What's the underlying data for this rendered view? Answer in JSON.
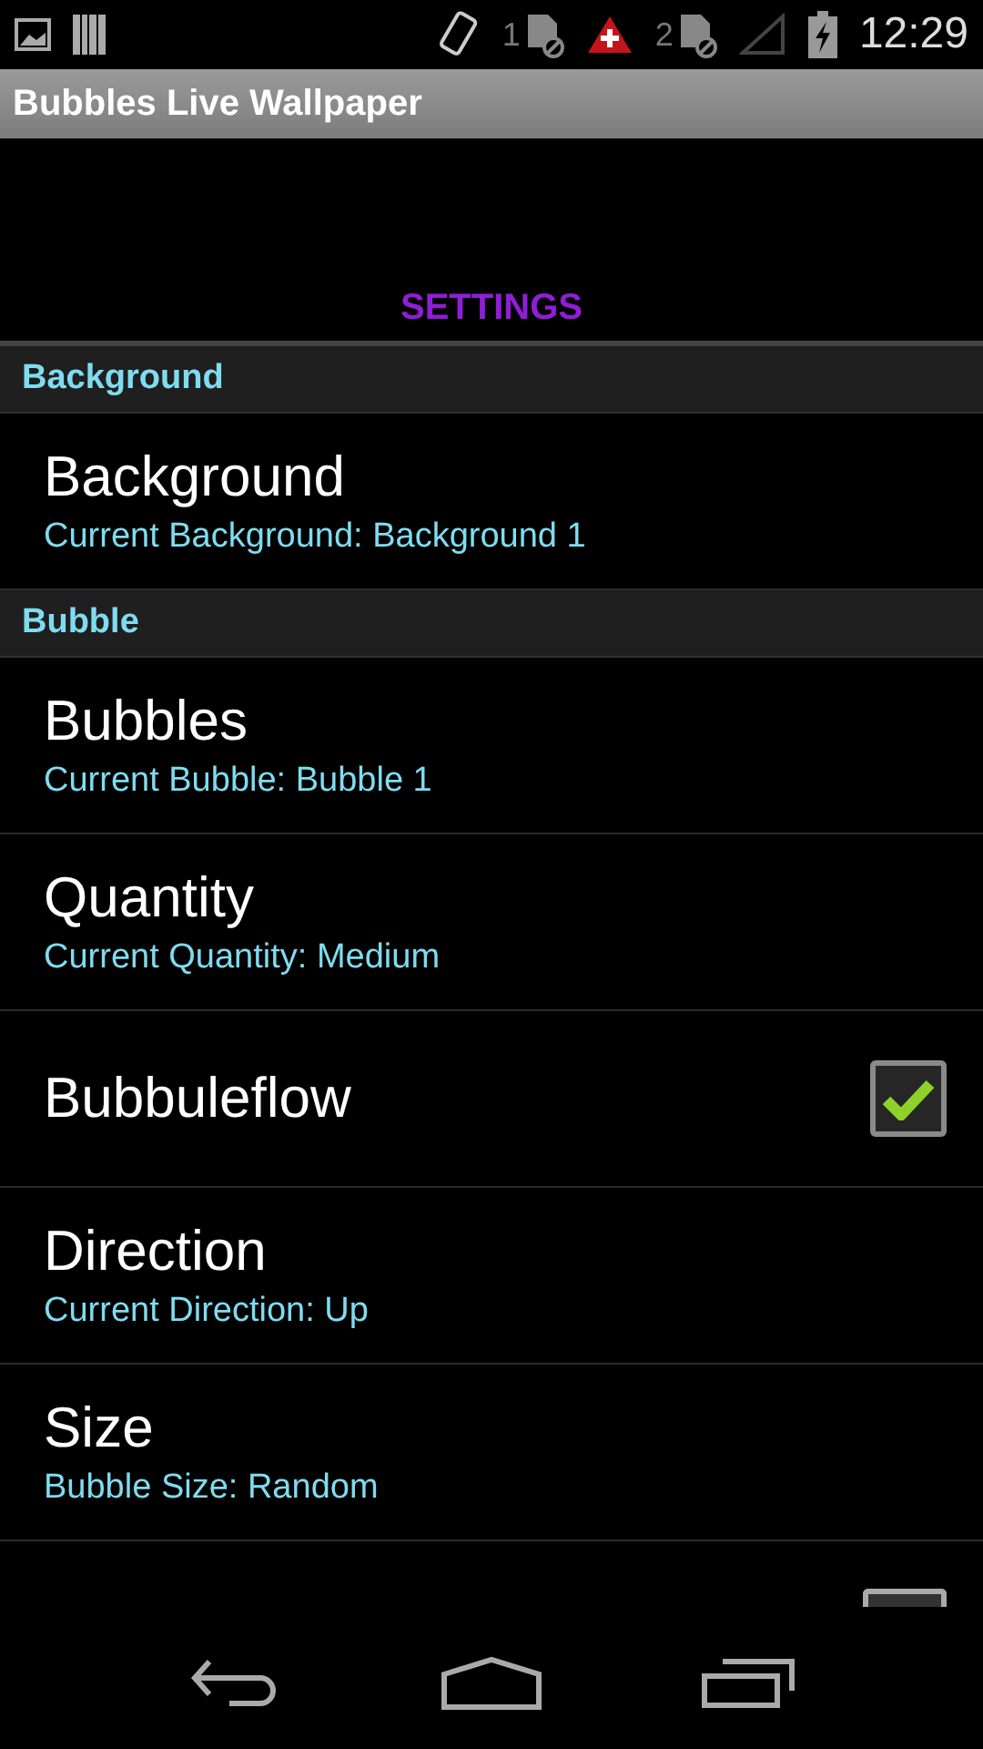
{
  "status_bar": {
    "sim_slots": [
      "1",
      "2"
    ],
    "time": "12:29"
  },
  "title_bar": {
    "title": "Bubbles Live Wallpaper"
  },
  "header": {
    "title": "SETTINGS"
  },
  "sections": [
    {
      "title": "Background",
      "items": [
        {
          "kind": "summary",
          "title": "Background",
          "summary": "Current Background: Background 1"
        }
      ]
    },
    {
      "title": "Bubble",
      "items": [
        {
          "kind": "summary",
          "title": "Bubbles",
          "summary": "Current Bubble: Bubble 1"
        },
        {
          "kind": "summary",
          "title": "Quantity",
          "summary": "Current Quantity: Medium"
        },
        {
          "kind": "checkbox",
          "title": "Bubbuleflow",
          "checked": true
        },
        {
          "kind": "summary",
          "title": "Direction",
          "summary": "Current Direction: Up"
        },
        {
          "kind": "summary",
          "title": "Size",
          "summary": "Bubble Size: Random"
        },
        {
          "kind": "partial_checkbox"
        }
      ]
    }
  ]
}
